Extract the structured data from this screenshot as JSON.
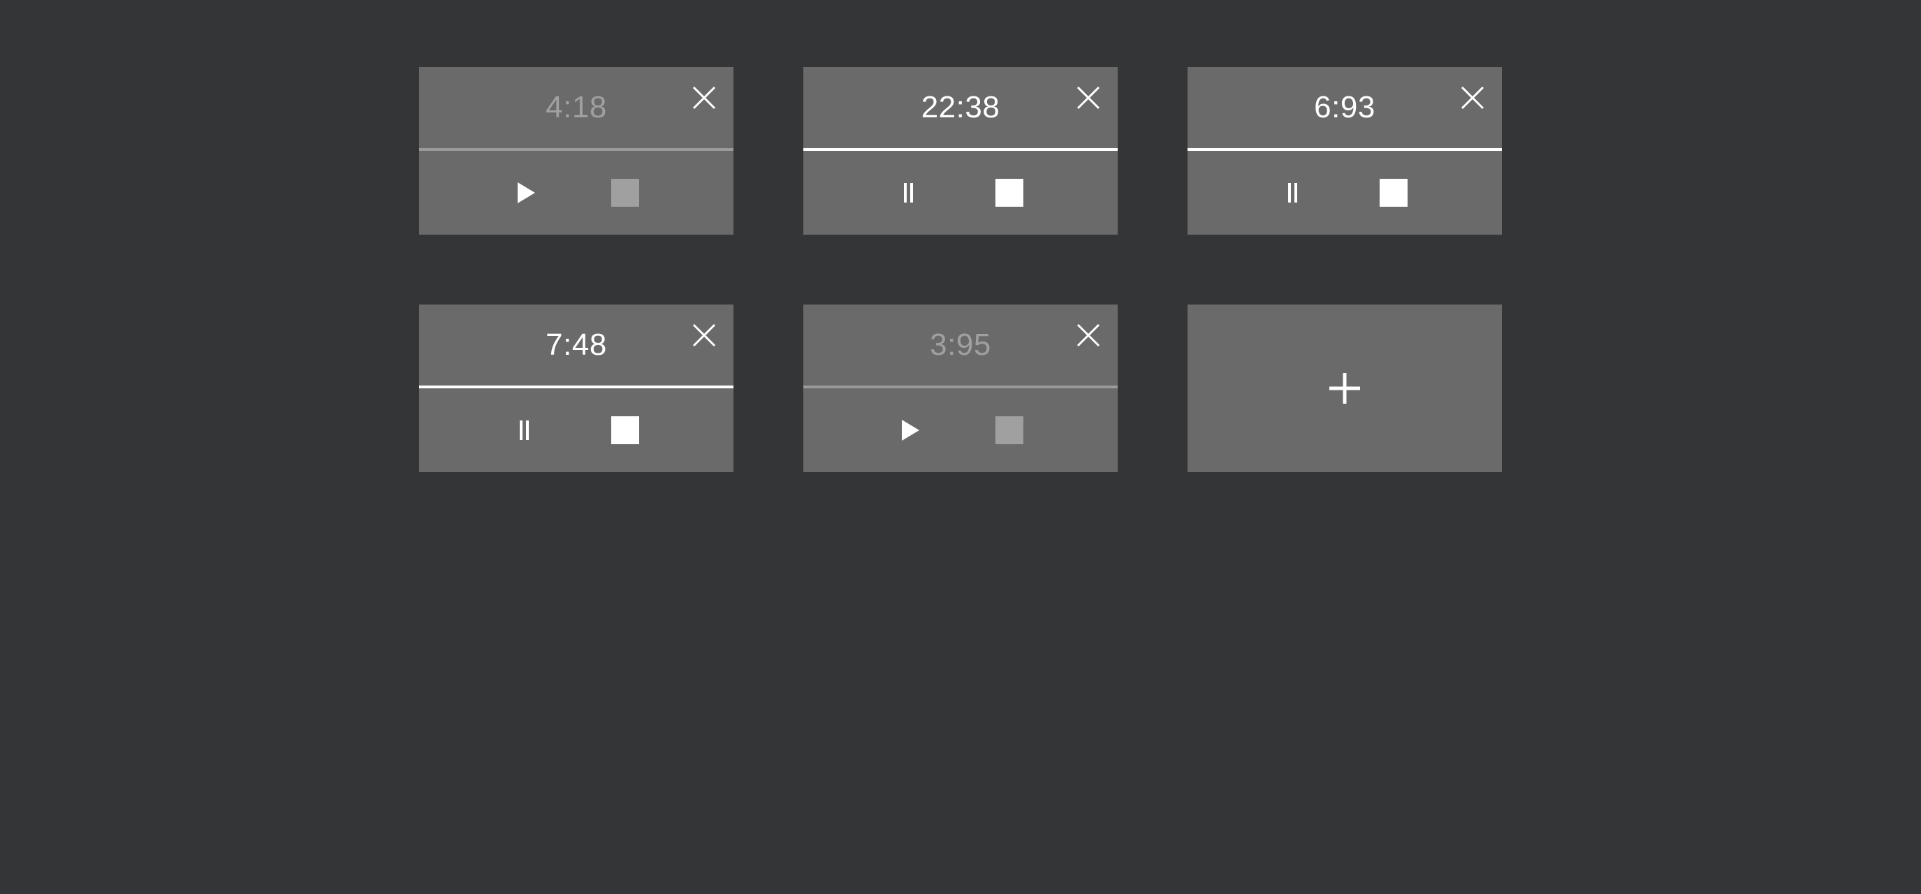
{
  "timers": [
    {
      "time": "4:18",
      "running": false
    },
    {
      "time": "22:38",
      "running": true
    },
    {
      "time": "6:93",
      "running": true
    },
    {
      "time": "7:48",
      "running": true
    },
    {
      "time": "3:95",
      "running": false
    }
  ],
  "icons": {
    "close": "close-icon",
    "play": "play-icon",
    "pause": "pause-icon",
    "stop": "stop-icon",
    "add": "plus-icon"
  },
  "colors": {
    "background": "#343537",
    "card": "#6a6a6a",
    "active": "#ffffff",
    "inactive": "#a0a0a0"
  }
}
